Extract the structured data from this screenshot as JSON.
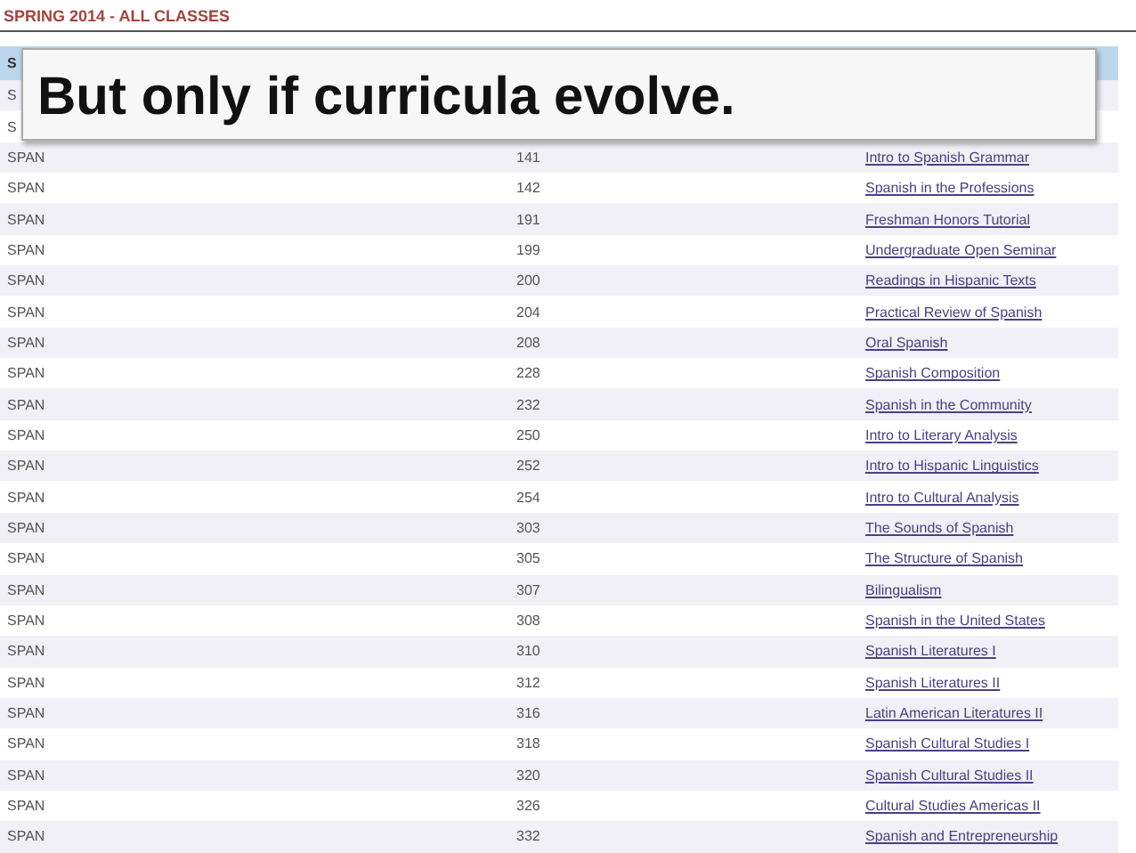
{
  "page_title": "SPRING 2014 - ALL CLASSES",
  "table": {
    "header": [
      "S"
    ],
    "rows": [
      {
        "column_1": "S"
      },
      {
        "column_1": "S"
      },
      {
        "column_1": "SPAN",
        "column_2": "141",
        "column_3": "Intro to Spanish Grammar"
      },
      {
        "column_1": "SPAN",
        "column_2": "142",
        "column_3": "Spanish in the Professions"
      },
      {
        "column_1": "SPAN",
        "column_2": "191",
        "column_3": "Freshman Honors Tutorial"
      },
      {
        "column_1": "SPAN",
        "column_2": "199",
        "column_3": "Undergraduate Open Seminar"
      },
      {
        "column_1": "SPAN",
        "column_2": "200",
        "column_3": "Readings in Hispanic Texts"
      },
      {
        "column_1": "SPAN",
        "column_2": "204",
        "column_3": "Practical Review of Spanish"
      },
      {
        "column_1": "SPAN",
        "column_2": "208",
        "column_3": "Oral Spanish"
      },
      {
        "column_1": "SPAN",
        "column_2": "228",
        "column_3": "Spanish Composition"
      },
      {
        "column_1": "SPAN",
        "column_2": "232",
        "column_3": "Spanish in the Community"
      },
      {
        "column_1": "SPAN",
        "column_2": "250",
        "column_3": "Intro to Literary Analysis"
      },
      {
        "column_1": "SPAN",
        "column_2": "252",
        "column_3": "Intro to Hispanic Linguistics"
      },
      {
        "column_1": "SPAN",
        "column_2": "254",
        "column_3": "Intro to Cultural Analysis"
      },
      {
        "column_1": "SPAN",
        "column_2": "303",
        "column_3": "The Sounds of Spanish"
      },
      {
        "column_1": "SPAN",
        "column_2": "305",
        "column_3": "The Structure of Spanish"
      },
      {
        "column_1": "SPAN",
        "column_2": "307",
        "column_3": "Bilingualism"
      },
      {
        "column_1": "SPAN",
        "column_2": "308",
        "column_3": "Spanish in the United States"
      },
      {
        "column_1": "SPAN",
        "column_2": "310",
        "column_3": "Spanish Literatures I"
      },
      {
        "column_1": "SPAN",
        "column_2": "312",
        "column_3": "Spanish Literatures II"
      },
      {
        "column_1": "SPAN",
        "column_2": "316",
        "column_3": "Latin American Literatures II"
      },
      {
        "column_1": "SPAN",
        "column_2": "318",
        "column_3": "Spanish Cultural Studies I"
      },
      {
        "column_1": "SPAN",
        "column_2": "320",
        "column_3": "Spanish Cultural Studies II"
      },
      {
        "column_1": "SPAN",
        "column_2": "326",
        "column_3": "Cultural Studies Americas II"
      },
      {
        "column_1": "SPAN",
        "column_2": "332",
        "column_3": "Spanish and Entrepreneurship"
      }
    ]
  },
  "callout": "But only if curricula evolve."
}
